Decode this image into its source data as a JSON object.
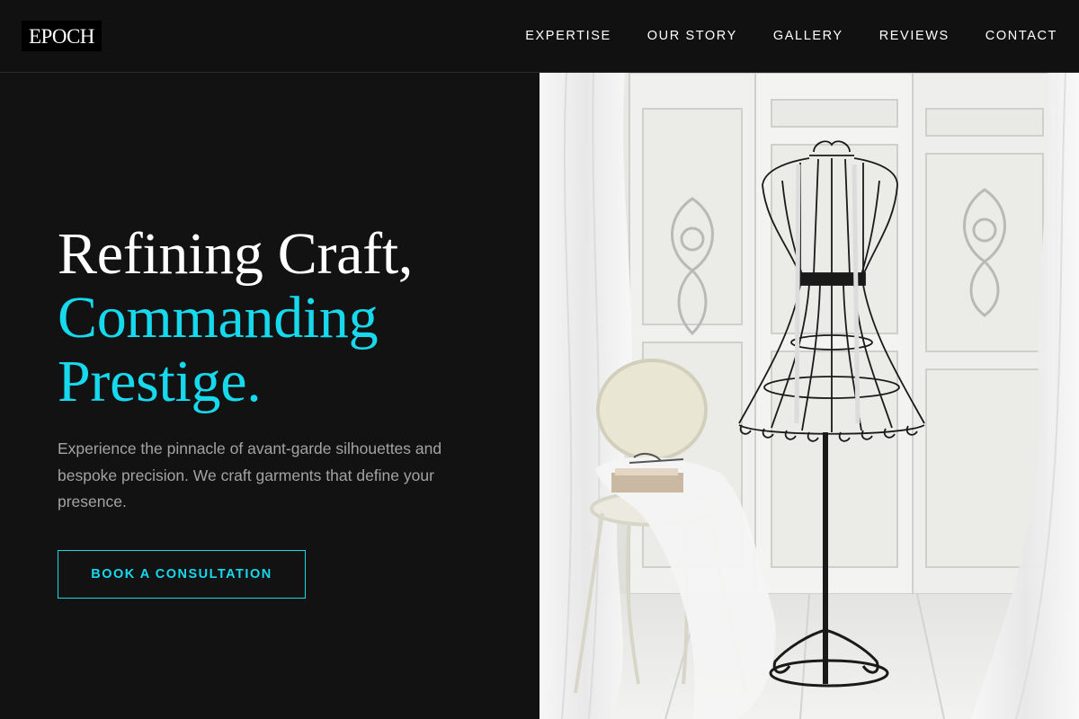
{
  "brand": {
    "logo_text": "EPOCH"
  },
  "nav": {
    "items": [
      {
        "label": "EXPERTISE"
      },
      {
        "label": "OUR STORY"
      },
      {
        "label": "GALLERY"
      },
      {
        "label": "REVIEWS"
      },
      {
        "label": "CONTACT"
      }
    ]
  },
  "hero": {
    "headline_line1": "Refining Craft,",
    "headline_line2": "Commanding",
    "headline_line3": "Prestige.",
    "description": "Experience the pinnacle of avant-garde silhouettes and bespoke precision. We craft garments that define your presence.",
    "cta_label": "BOOK A CONSULTATION"
  },
  "colors": {
    "background": "#121212",
    "accent": "#17d9ee",
    "body_text": "#a3a3a6",
    "heading": "#ffffff"
  }
}
